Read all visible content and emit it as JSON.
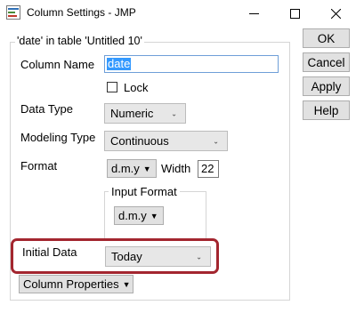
{
  "window": {
    "title": "Column Settings - JMP",
    "minimize_glyph": "—",
    "maximize_glyph": "☐",
    "close_glyph": "✕"
  },
  "group": {
    "title": "'date' in table 'Untitled 10'"
  },
  "fields": {
    "column_name_label": "Column Name",
    "column_name_value": "date",
    "lock_label": "Lock",
    "lock_checked": false,
    "data_type_label": "Data Type",
    "data_type_value": "Numeric",
    "modeling_type_label": "Modeling Type",
    "modeling_type_value": "Continuous",
    "format_label": "Format",
    "format_value": "d.m.y",
    "width_label": "Width",
    "width_value": "22",
    "input_format_title": "Input Format",
    "input_format_value": "d.m.y",
    "initial_data_label": "Initial Data",
    "initial_data_value": "Today",
    "column_properties_label": "Column Properties"
  },
  "buttons": {
    "ok": "OK",
    "cancel": "Cancel",
    "apply": "Apply",
    "help": "Help"
  },
  "colors": {
    "highlight_border": "#a3262f",
    "selection": "#3399ff",
    "input_focus_border": "#6f9fd8"
  },
  "icons": {
    "app": "jmp-app-icon",
    "combo_arrow": "chevron-down-icon",
    "dropdown_arrow": "triangle-down-icon"
  }
}
